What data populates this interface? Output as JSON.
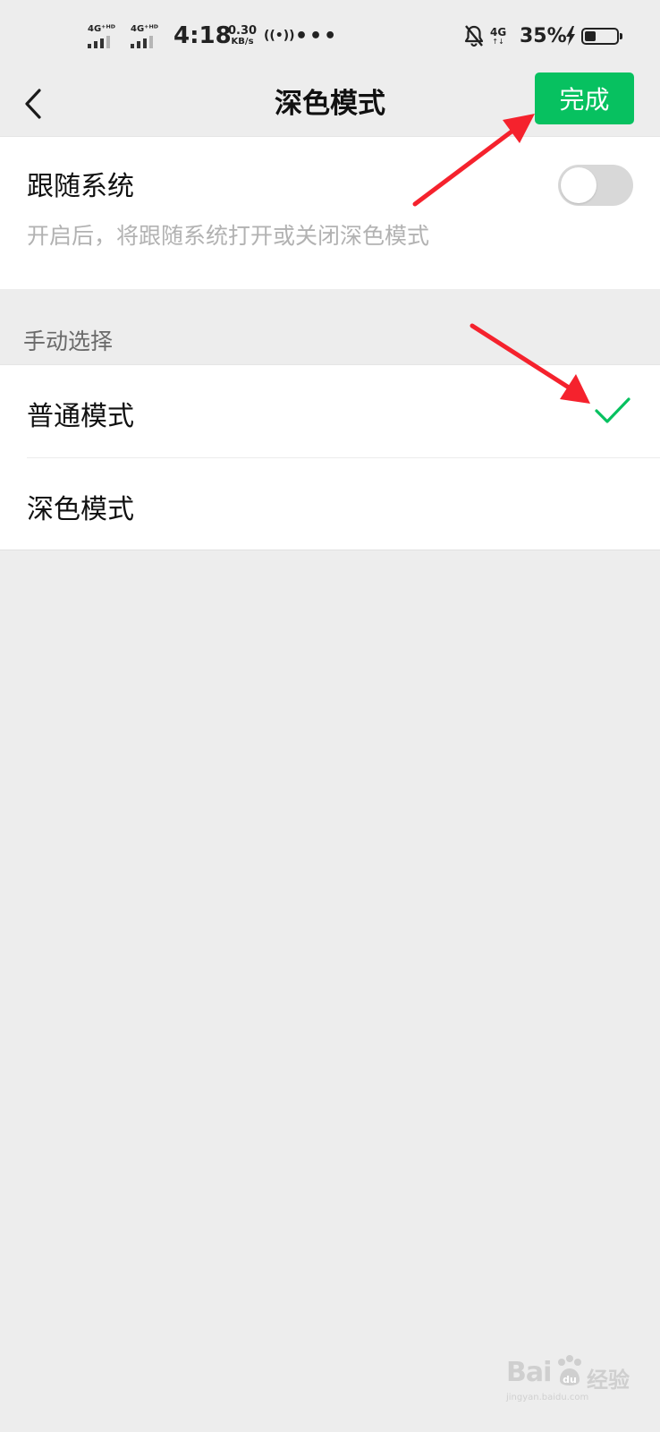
{
  "status_bar": {
    "signal_1": "4G⁺ᴴᴰ",
    "signal_2": "4G⁺ᴴᴰ",
    "time": "4:18",
    "speed_value": "0.30",
    "speed_unit": "KB/s",
    "hotspot": "((•))",
    "more": "•••",
    "network": "4G",
    "network_arrows": "↑↓",
    "battery_percent": "35%",
    "battery_level": 0.35
  },
  "nav": {
    "title": "深色模式",
    "done_label": "完成",
    "accent_color": "#07c160"
  },
  "follow_system": {
    "title": "跟随系统",
    "description": "开启后，将跟随系统打开或关闭深色模式",
    "enabled": false
  },
  "manual": {
    "section_label": "手动选择",
    "options": [
      {
        "label": "普通模式",
        "selected": true
      },
      {
        "label": "深色模式",
        "selected": false
      }
    ]
  },
  "watermark": {
    "brand": "Bai",
    "suffix": "经验",
    "domain": "jingyan.baidu.com"
  },
  "annotation_color": "#f5222d"
}
